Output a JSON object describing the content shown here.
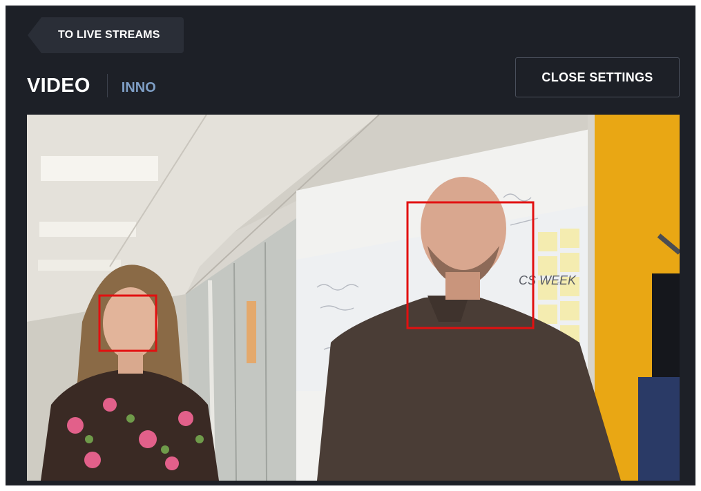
{
  "header": {
    "back_label": "TO LIVE STREAMS",
    "title": "VIDEO",
    "subtitle": "INNO",
    "close_label": "CLOSE SETTINGS"
  },
  "video": {
    "whiteboard_text": "CS WEEK",
    "detections": [
      {
        "label": "face-left"
      },
      {
        "label": "face-right"
      }
    ],
    "box_color": "#e21010"
  },
  "colors": {
    "panel_bg": "#1d2027",
    "button_bg": "#2a2e37",
    "subtitle": "#7f9fc6",
    "accent_wall": "#e9a714"
  }
}
